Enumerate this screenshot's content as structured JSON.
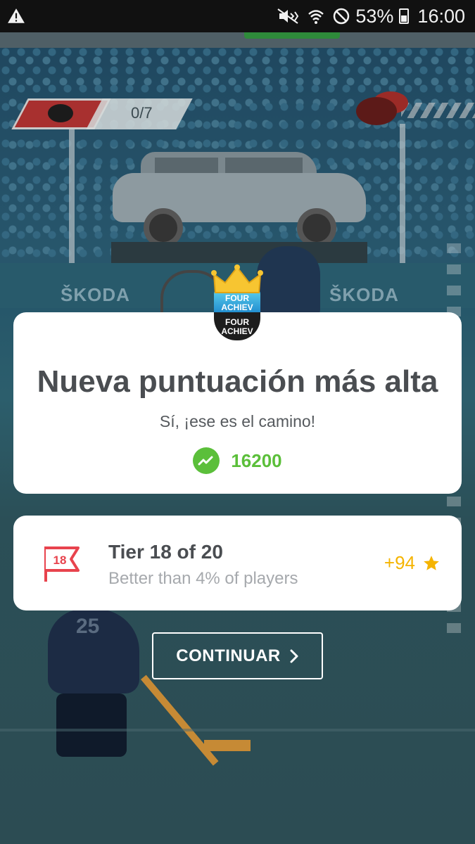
{
  "status_bar": {
    "battery": "53%",
    "time": "16:00",
    "icons": [
      "warning-icon",
      "mute-icon",
      "wifi-icon",
      "do-not-disturb-icon",
      "battery-icon"
    ]
  },
  "game": {
    "score_counter": "0/7",
    "brand_left": "ŠKODA",
    "brand_right": "ŠKODA",
    "player_number": "25",
    "badge_text_top": "FOUR ACHIEV",
    "badge_text_bottom": "FOUR ACHIEV"
  },
  "highscore_card": {
    "title": "Nueva puntuación más alta",
    "subtitle": "Sí, ¡ese es el camino!",
    "score": "16200",
    "score_icon": "trend-up-icon",
    "score_color": "#5bbf3a"
  },
  "tier_card": {
    "flag_number": "18",
    "title": "Tier 18 of 20",
    "subtitle": "Better than 4% of players",
    "points": "+94",
    "points_icon": "star-icon",
    "flag_color": "#e8434d",
    "points_color": "#f5b400"
  },
  "continue_button": {
    "label": "CONTINUAR"
  }
}
